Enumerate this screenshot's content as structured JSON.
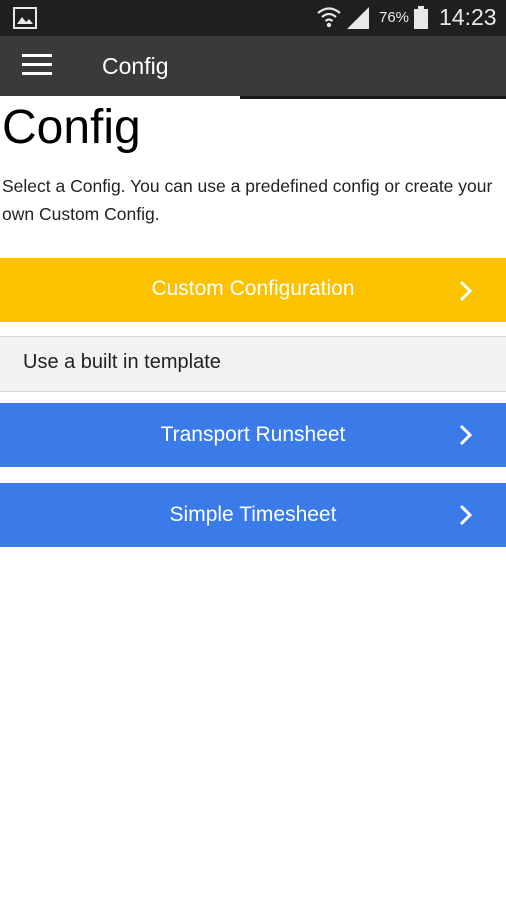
{
  "status_bar": {
    "battery_percent": "76%",
    "time": "14:23",
    "icons": [
      "image-icon",
      "wifi-icon",
      "signal-icon",
      "battery-icon"
    ]
  },
  "app_bar": {
    "title": "Config",
    "menu_icon": "hamburger-menu-icon"
  },
  "page": {
    "title": "Config",
    "description": "Select a Config. You can use a predefined config or create your own Custom Config."
  },
  "options": {
    "custom": {
      "label": "Custom Configuration",
      "color": "#fcc200"
    },
    "section_label": "Use a built in template",
    "templates": [
      {
        "label": "Transport Runsheet",
        "color": "#3b7be9"
      },
      {
        "label": "Simple Timesheet",
        "color": "#3b7be9"
      }
    ],
    "chevron_icon": "chevron-right-icon"
  }
}
